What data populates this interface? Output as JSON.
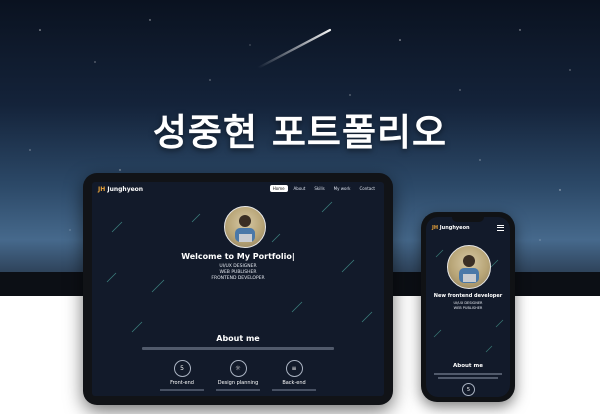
{
  "hero": {
    "title": "성중현 포트폴리오"
  },
  "tablet": {
    "logo_prefix": "JH",
    "logo_name": "Junghyeon",
    "menu": [
      {
        "label": "Home",
        "active": true
      },
      {
        "label": "About",
        "active": false
      },
      {
        "label": "Skills",
        "active": false
      },
      {
        "label": "My work",
        "active": false
      },
      {
        "label": "Contact",
        "active": false
      }
    ],
    "welcome": "Welcome to My Portfolio|",
    "roles": [
      "UI/UX DESIGNER",
      "WEB PUBLISHER",
      "FRONTEND DEVELOPER"
    ],
    "about_title": "About me",
    "skills": [
      {
        "icon": "html5-icon",
        "glyph": "5",
        "label": "Front-end"
      },
      {
        "icon": "lightbulb-icon",
        "glyph": "☼",
        "label": "Design planning"
      },
      {
        "icon": "database-icon",
        "glyph": "≡",
        "label": "Back-end"
      }
    ]
  },
  "phone": {
    "logo_prefix": "JH",
    "logo_name": "Junghyeon",
    "title": "New frontend developer",
    "roles": [
      "UI/UX DESIGNER",
      "WEB PUBLISHER"
    ],
    "about_title": "About me",
    "icon_glyph": "5"
  },
  "colors": {
    "accent": "#e8a23a",
    "screen_bg": "#121a2a",
    "device_frame": "#111317"
  }
}
